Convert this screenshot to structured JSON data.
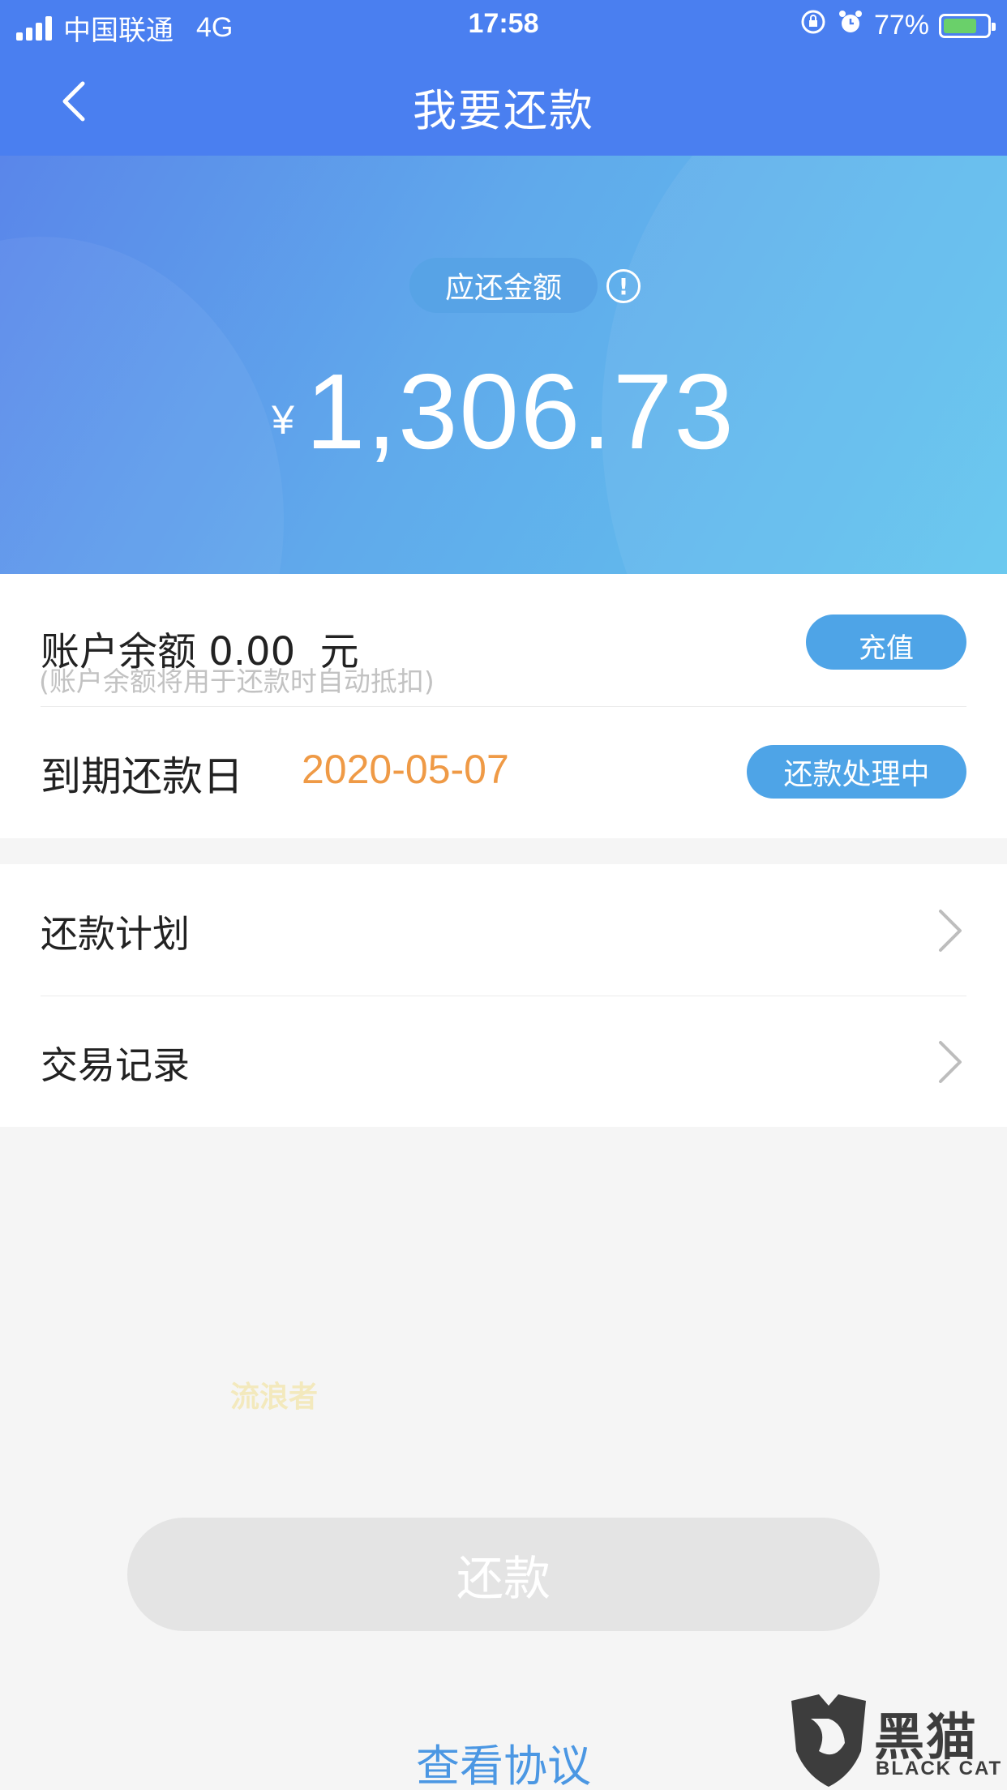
{
  "status_bar": {
    "carrier": "中国联通",
    "network": "4G",
    "time": "17:58",
    "battery_percent": "77%",
    "battery_level": 0.77
  },
  "nav": {
    "title": "我要还款"
  },
  "hero": {
    "due_label": "应还金额",
    "info_icon_text": "!",
    "currency_symbol": "¥",
    "amount": "1,306.73"
  },
  "account": {
    "balance_label": "账户余额 0.00  元",
    "balance_note": "(账户余额将用于还款时自动抵扣)",
    "recharge_label": "充值"
  },
  "due": {
    "label": "到期还款日",
    "date": "2020-05-07",
    "status_label": "还款处理中"
  },
  "menu": {
    "items": [
      {
        "label": "还款计划"
      },
      {
        "label": "交易记录"
      }
    ]
  },
  "watermark_text": "流浪者",
  "repay_button_label": "还款",
  "agreement_link_label": "查看协议",
  "logo": {
    "name": "黑猫",
    "sub": "BLACK CAT"
  },
  "colors": {
    "nav_blue": "#4a7ff0",
    "button_blue": "#4ea4e7",
    "date_orange": "#ef9a46",
    "link_blue": "#4b97e3",
    "disabled_gray": "#e4e4e4"
  }
}
